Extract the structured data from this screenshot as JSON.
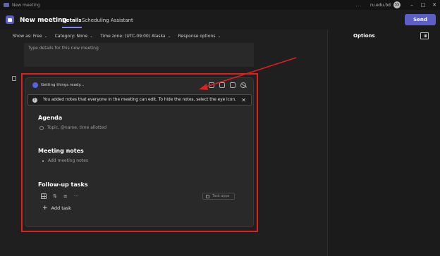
{
  "titlebar": {
    "title": "New meeting",
    "more": "...",
    "account": "ru.edu.bd",
    "avatar_initials": "SS",
    "minimize": "–",
    "maximize": "□",
    "close": "✕"
  },
  "header": {
    "title": "New meeting",
    "tabs": [
      "Details",
      "Scheduling Assistant"
    ],
    "send_label": "Send"
  },
  "toolbar": {
    "show_as": "Show as: Free",
    "category": "Category: None",
    "time_zone": "Time zone: (UTC-09:00) Alaska",
    "response_options": "Response options"
  },
  "details": {
    "placeholder": "Type details for this new meeting"
  },
  "options_panel": {
    "title": "Options"
  },
  "card": {
    "status": "Getting things ready...",
    "info": "You added notes that everyone in the meeting can edit. To hide the notes, select the eye icon.",
    "agenda": {
      "title": "Agenda",
      "placeholder": "Topic, @name, time allotted"
    },
    "notes": {
      "title": "Meeting notes",
      "placeholder": "Add meeting notes"
    },
    "tasks": {
      "title": "Follow-up tasks",
      "task_app": "Task apps",
      "add_task": "Add task"
    }
  },
  "colors": {
    "accent": "#5b5fc7",
    "highlight": "#e01f1f",
    "background": "#1f1f1f"
  }
}
